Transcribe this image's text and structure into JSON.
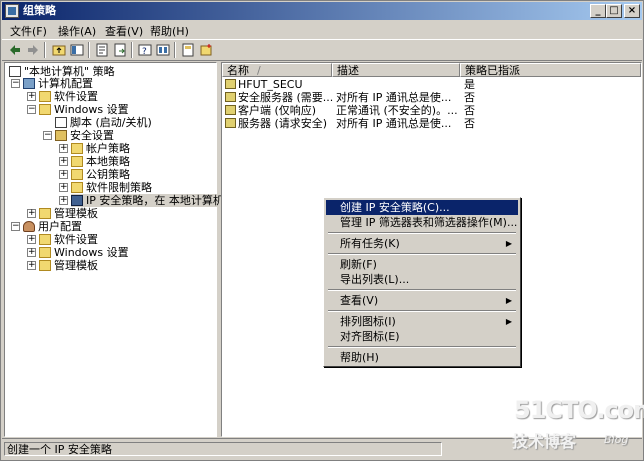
{
  "window": {
    "title": "组策略"
  },
  "menubar": [
    "文件(F)",
    "操作(A)",
    "查看(V)",
    "帮助(H)"
  ],
  "tree": [
    {
      "label": "\"本地计算机\" 策略",
      "icon": "policy-icon"
    },
    {
      "label": "计算机配置",
      "icon": "computer-icon"
    },
    {
      "label": "软件设置",
      "icon": "folder-icon"
    },
    {
      "label": "Windows 设置",
      "icon": "folder-icon"
    },
    {
      "label": "脚本 (启动/关机)",
      "icon": "script-icon"
    },
    {
      "label": "安全设置",
      "icon": "security-icon"
    },
    {
      "label": "帐户策略",
      "icon": "folder-icon"
    },
    {
      "label": "本地策略",
      "icon": "folder-icon"
    },
    {
      "label": "公钥策略",
      "icon": "folder-icon"
    },
    {
      "label": "软件限制策略",
      "icon": "folder-icon"
    },
    {
      "label": "IP 安全策略，在 本地计算机",
      "icon": "ipsec-icon"
    },
    {
      "label": "管理模板",
      "icon": "folder-icon"
    },
    {
      "label": "用户配置",
      "icon": "user-icon"
    },
    {
      "label": "软件设置",
      "icon": "folder-icon"
    },
    {
      "label": "Windows 设置",
      "icon": "folder-icon"
    },
    {
      "label": "管理模板",
      "icon": "folder-icon"
    }
  ],
  "columns": [
    "名称",
    "描述",
    "策略已指派"
  ],
  "sort_indicator": "/",
  "rows": [
    {
      "name": "HFUT_SECU",
      "desc": "",
      "assigned": "是"
    },
    {
      "name": "安全服务器 (需要...",
      "desc": "对所有 IP 通讯总是使...",
      "assigned": "否"
    },
    {
      "name": "客户端 (仅响应)",
      "desc": "正常通讯 (不安全的)。...",
      "assigned": "否"
    },
    {
      "name": "服务器 (请求安全)",
      "desc": "对所有 IP 通讯总是使...",
      "assigned": "否"
    }
  ],
  "context_menu": [
    {
      "label": "创建 IP 安全策略(C)...",
      "highlighted": true,
      "submenu": false
    },
    {
      "label": "管理 IP 筛选器表和筛选器操作(M)...",
      "highlighted": false,
      "submenu": false
    },
    {
      "label": "所有任务(K)",
      "highlighted": false,
      "submenu": true
    },
    {
      "label": "刷新(F)",
      "highlighted": false,
      "submenu": false
    },
    {
      "label": "导出列表(L)...",
      "highlighted": false,
      "submenu": false
    },
    {
      "label": "查看(V)",
      "highlighted": false,
      "submenu": true
    },
    {
      "label": "排列图标(I)",
      "highlighted": false,
      "submenu": true
    },
    {
      "label": "对齐图标(E)",
      "highlighted": false,
      "submenu": false
    },
    {
      "label": "帮助(H)",
      "highlighted": false,
      "submenu": false
    }
  ],
  "status": "创建一个 IP 安全策略",
  "watermark": {
    "site": "51CTO.com",
    "line": "技术博客",
    "tag": "Blog"
  },
  "colors": {
    "title_start": "#0a246a",
    "title_end": "#a6caf0",
    "highlight": "#0a246a",
    "face": "#d4d0c8"
  }
}
